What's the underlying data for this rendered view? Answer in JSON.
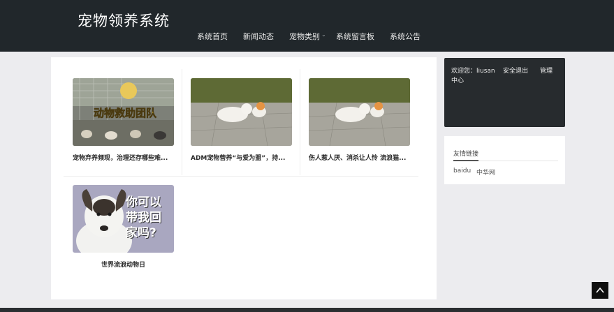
{
  "header": {
    "title": "宠物领养系统",
    "nav": [
      "系统首页",
      "新闻动态",
      "宠物类别",
      "系统留言板",
      "系统公告"
    ]
  },
  "cards": [
    {
      "title": "宠物弃养频现，治理还存哪些难...",
      "image": "rescue-team-photo",
      "image_text": "动物救助团队"
    },
    {
      "title": "ADM宠物营养“与爱为盟”，持...",
      "image": "kittens-photo"
    },
    {
      "title": "伤人惹人厌、消杀让人怜 流浪猫...",
      "image": "kittens-photo"
    },
    {
      "title": "世界流浪动物日",
      "image": "dog-photo",
      "image_text": "你可以带我回家吗?"
    }
  ],
  "sidebar": {
    "welcome": "欢迎您：liusan",
    "logout": "安全退出",
    "manage_line1": "管理",
    "manage_line2": "中心",
    "links_title": "友情链接",
    "links": [
      "baidu",
      "中华网"
    ]
  },
  "icons": {
    "back_to_top": "chevron-up-icon",
    "dropdown": "chevron-down-icon"
  },
  "colors": {
    "topbar": "#21272b",
    "page_bg": "#ececef",
    "userbox": "#272b2e"
  }
}
